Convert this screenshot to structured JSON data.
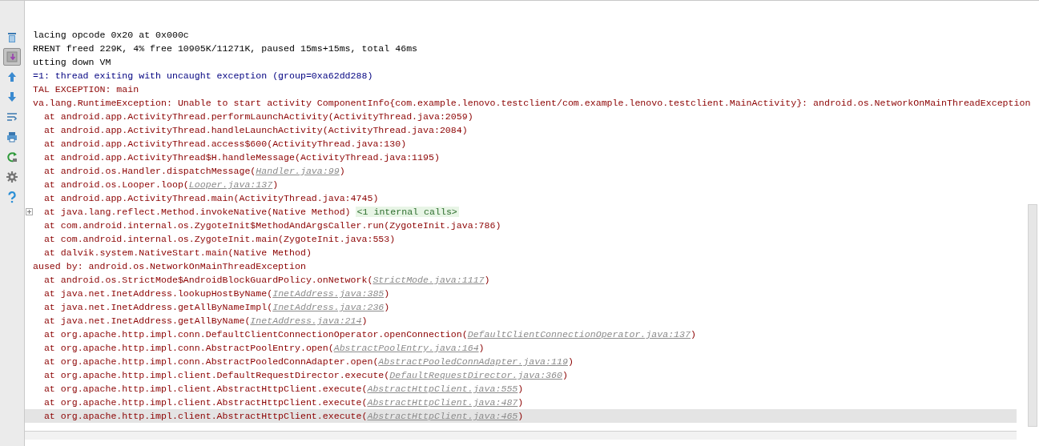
{
  "toolbar": [
    {
      "selected": false
    },
    {
      "selected": true
    },
    {
      "selected": false
    },
    {
      "selected": false
    },
    {
      "selected": false
    },
    {
      "selected": false
    },
    {
      "selected": false
    },
    {
      "selected": false
    },
    {
      "selected": false
    }
  ],
  "log_lines": [
    {
      "kind": "info",
      "text": "lacing opcode 0x20 at 0x000c",
      "selected": false
    },
    {
      "kind": "info",
      "text": "RRENT freed 229K, 4% free 10905K/11271K, paused 15ms+15ms, total 46ms",
      "selected": false
    },
    {
      "kind": "info",
      "text": "utting down VM",
      "selected": false
    },
    {
      "kind": "warn",
      "text": "=1: thread exiting with uncaught exception (group=0xa62dd288)",
      "selected": false
    },
    {
      "kind": "error",
      "text": "TAL EXCEPTION: main",
      "selected": false
    },
    {
      "kind": "error",
      "text": "va.lang.RuntimeException: Unable to start activity ComponentInfo{com.example.lenovo.testclient/com.example.lenovo.testclient.MainActivity}: android.os.NetworkOnMainThreadException",
      "selected": false
    },
    {
      "kind": "error",
      "text": "  at android.app.ActivityThread.performLaunchActivity(ActivityThread.java:2059)",
      "selected": false
    },
    {
      "kind": "error",
      "text": "  at android.app.ActivityThread.handleLaunchActivity(ActivityThread.java:2084)",
      "selected": false
    },
    {
      "kind": "error",
      "text": "  at android.app.ActivityThread.access$600(ActivityThread.java:130)",
      "selected": false
    },
    {
      "kind": "error",
      "text": "  at android.app.ActivityThread$H.handleMessage(ActivityThread.java:1195)",
      "selected": false
    },
    {
      "kind": "error",
      "text": "  at android.os.Handler.dispatchMessage(",
      "link": "Handler.java:99",
      "tail": ")",
      "selected": false
    },
    {
      "kind": "error",
      "text": "  at android.os.Looper.loop(",
      "link": "Looper.java:137",
      "tail": ")",
      "selected": false
    },
    {
      "kind": "error",
      "text": "  at android.app.ActivityThread.main(ActivityThread.java:4745)",
      "selected": false
    },
    {
      "kind": "error",
      "text": "  at java.lang.reflect.Method.invokeNative(Native Method)",
      "fold": {
        "collapsed": true,
        "label": "<1 internal calls>"
      },
      "selected": false
    },
    {
      "kind": "error",
      "text": "  at com.android.internal.os.ZygoteInit$MethodAndArgsCaller.run(ZygoteInit.java:786)",
      "selected": false
    },
    {
      "kind": "error",
      "text": "  at com.android.internal.os.ZygoteInit.main(ZygoteInit.java:553)",
      "selected": false
    },
    {
      "kind": "error",
      "text": "  at dalvik.system.NativeStart.main(Native Method)",
      "selected": false
    },
    {
      "kind": "error",
      "text": "aused by: android.os.NetworkOnMainThreadException",
      "selected": false
    },
    {
      "kind": "error",
      "text": "  at android.os.StrictMode$AndroidBlockGuardPolicy.onNetwork(",
      "link": "StrictMode.java:1117",
      "tail": ")",
      "selected": false
    },
    {
      "kind": "error",
      "text": "  at java.net.InetAddress.lookupHostByName(",
      "link": "InetAddress.java:385",
      "tail": ")",
      "selected": false
    },
    {
      "kind": "error",
      "text": "  at java.net.InetAddress.getAllByNameImpl(",
      "link": "InetAddress.java:236",
      "tail": ")",
      "selected": false
    },
    {
      "kind": "error",
      "text": "  at java.net.InetAddress.getAllByName(",
      "link": "InetAddress.java:214",
      "tail": ")",
      "selected": false
    },
    {
      "kind": "error",
      "text": "  at org.apache.http.impl.conn.DefaultClientConnectionOperator.openConnection(",
      "link": "DefaultClientConnectionOperator.java:137",
      "tail": ")",
      "selected": false
    },
    {
      "kind": "error",
      "text": "  at org.apache.http.impl.conn.AbstractPoolEntry.open(",
      "link": "AbstractPoolEntry.java:164",
      "tail": ")",
      "selected": false
    },
    {
      "kind": "error",
      "text": "  at org.apache.http.impl.conn.AbstractPooledConnAdapter.open(",
      "link": "AbstractPooledConnAdapter.java:119",
      "tail": ")",
      "selected": false
    },
    {
      "kind": "error",
      "text": "  at org.apache.http.impl.client.DefaultRequestDirector.execute(",
      "link": "DefaultRequestDirector.java:360",
      "tail": ")",
      "selected": false
    },
    {
      "kind": "error",
      "text": "  at org.apache.http.impl.client.AbstractHttpClient.execute(",
      "link": "AbstractHttpClient.java:555",
      "tail": ")",
      "selected": false
    },
    {
      "kind": "error",
      "text": "  at org.apache.http.impl.client.AbstractHttpClient.execute(",
      "link": "AbstractHttpClient.java:487",
      "tail": ")",
      "selected": false
    },
    {
      "kind": "error",
      "text": "  at org.apache.http.impl.client.AbstractHttpClient.execute(",
      "link": "AbstractHttpClient.java:465",
      "tail": ")",
      "selected": true
    }
  ]
}
